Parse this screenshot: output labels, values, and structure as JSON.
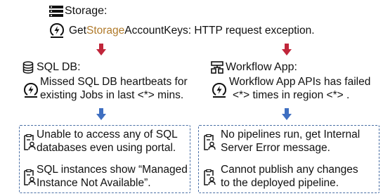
{
  "storage": {
    "label": "Storage:",
    "alert_prefix": "Get",
    "alert_highlight": "Storage",
    "alert_suffix": "AccountKeys: HTTP request exception."
  },
  "sql": {
    "label": "SQL DB:",
    "alert_line1": "Missed SQL DB heartbeats for",
    "alert_line2": "existing Jobs in last <*> mins.",
    "tickets": [
      {
        "line1": "Unable to access any of SQL",
        "line2": "databases even using portal."
      },
      {
        "line1": "SQL instances show “Managed",
        "line2": "Instance Not Available”."
      }
    ]
  },
  "workflow": {
    "label": "Workflow App:",
    "alert_line1": "Workflow App APIs has failed",
    "alert_line2": "<*> times in region <*> .",
    "tickets": [
      {
        "line1": "No pipelines run, get Internal",
        "line2": "Server Error message."
      },
      {
        "line1": "Cannot publish any changes",
        "line2": "to the deployed pipeline."
      }
    ]
  },
  "colors": {
    "arrow_red": "#c0263a",
    "arrow_blue": "#3f6fc1",
    "dashed_border": "#4a6fa5"
  },
  "icons": {
    "storage": "storage-icon",
    "alert": "lightning-alert-icon",
    "database": "database-icon",
    "workflow": "workflow-icon",
    "ticket": "ticket-person-icon"
  }
}
